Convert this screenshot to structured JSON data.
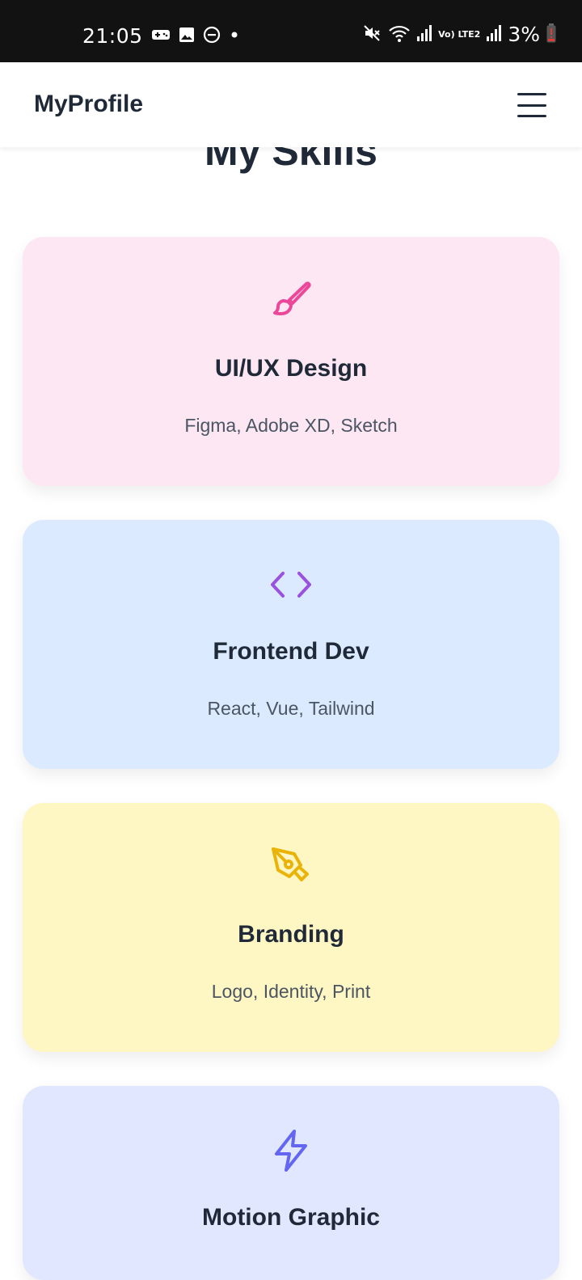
{
  "status_bar": {
    "time": "21:05",
    "battery": "3%",
    "network_label": "Vo) LTE2",
    "icons": [
      "game-icon",
      "image-icon",
      "dnd-icon",
      "dot-icon",
      "mute-icon",
      "wifi-icon",
      "signal-icon",
      "signal-icon",
      "battery-icon"
    ]
  },
  "navbar": {
    "brand": "MyProfile",
    "menu_icon": "hamburger-menu-icon"
  },
  "section": {
    "title": "My Skills"
  },
  "skills": [
    {
      "title": "UI/UX Design",
      "tools": "Figma, Adobe XD, Sketch",
      "icon": "paintbrush-icon",
      "color": "#ec4899",
      "bg": "#fce7f3"
    },
    {
      "title": "Frontend Dev",
      "tools": "React, Vue, Tailwind",
      "icon": "code-icon",
      "color": "#9b51e0",
      "bg": "#dbeafe"
    },
    {
      "title": "Branding",
      "tools": "Logo, Identity, Print",
      "icon": "pen-tool-icon",
      "color": "#eab308",
      "bg": "#fef7c3"
    },
    {
      "title": "Motion Graphic",
      "tools": "",
      "icon": "lightning-icon",
      "color": "#6366f1",
      "bg": "#e0e7ff"
    }
  ]
}
